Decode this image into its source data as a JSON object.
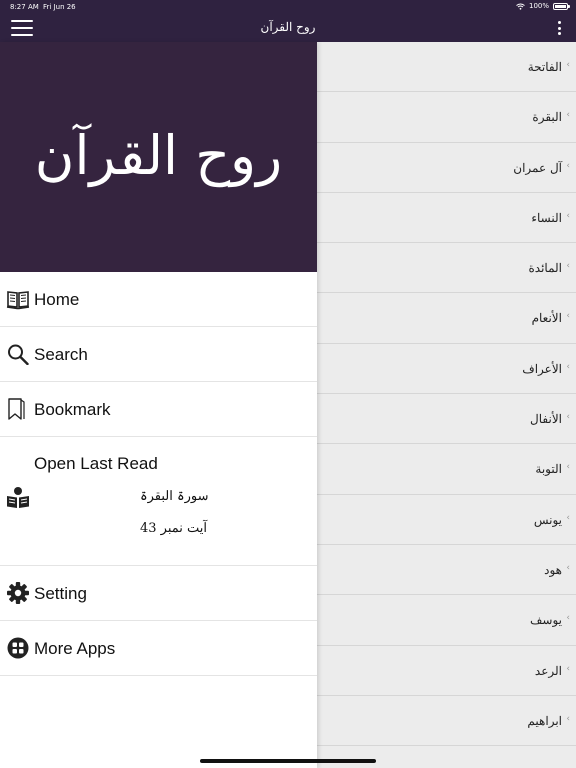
{
  "status_bar": {
    "time": "8:27 AM",
    "date": "Fri Jun 26",
    "battery": "100%"
  },
  "nav": {
    "title": "روح القرآن"
  },
  "drawer": {
    "logo": "روح القرآن",
    "items": [
      {
        "label": "Home",
        "icon": "book-open-icon"
      },
      {
        "label": "Search",
        "icon": "search-icon"
      },
      {
        "label": "Bookmark",
        "icon": "bookmark-icon"
      }
    ],
    "last_read": {
      "label": "Open Last Read",
      "surah": "سورۃ البقرۃ",
      "ayat": "آیت نمبر 43",
      "icon": "reader-icon"
    },
    "bottom_items": [
      {
        "label": "Setting",
        "icon": "gear-icon"
      },
      {
        "label": "More Apps",
        "icon": "apps-icon"
      }
    ]
  },
  "surahs": [
    "الفاتحة",
    "البقرة",
    "آل عمران",
    "النساء",
    "المائدة",
    "الأنعام",
    "الأعراف",
    "الأنفال",
    "التوبة",
    "يونس",
    "هود",
    "يوسف",
    "الرعد",
    "ابراهيم"
  ],
  "colors": {
    "primary": "#2f2240",
    "header": "#35243f",
    "list_bg": "#ececec"
  }
}
